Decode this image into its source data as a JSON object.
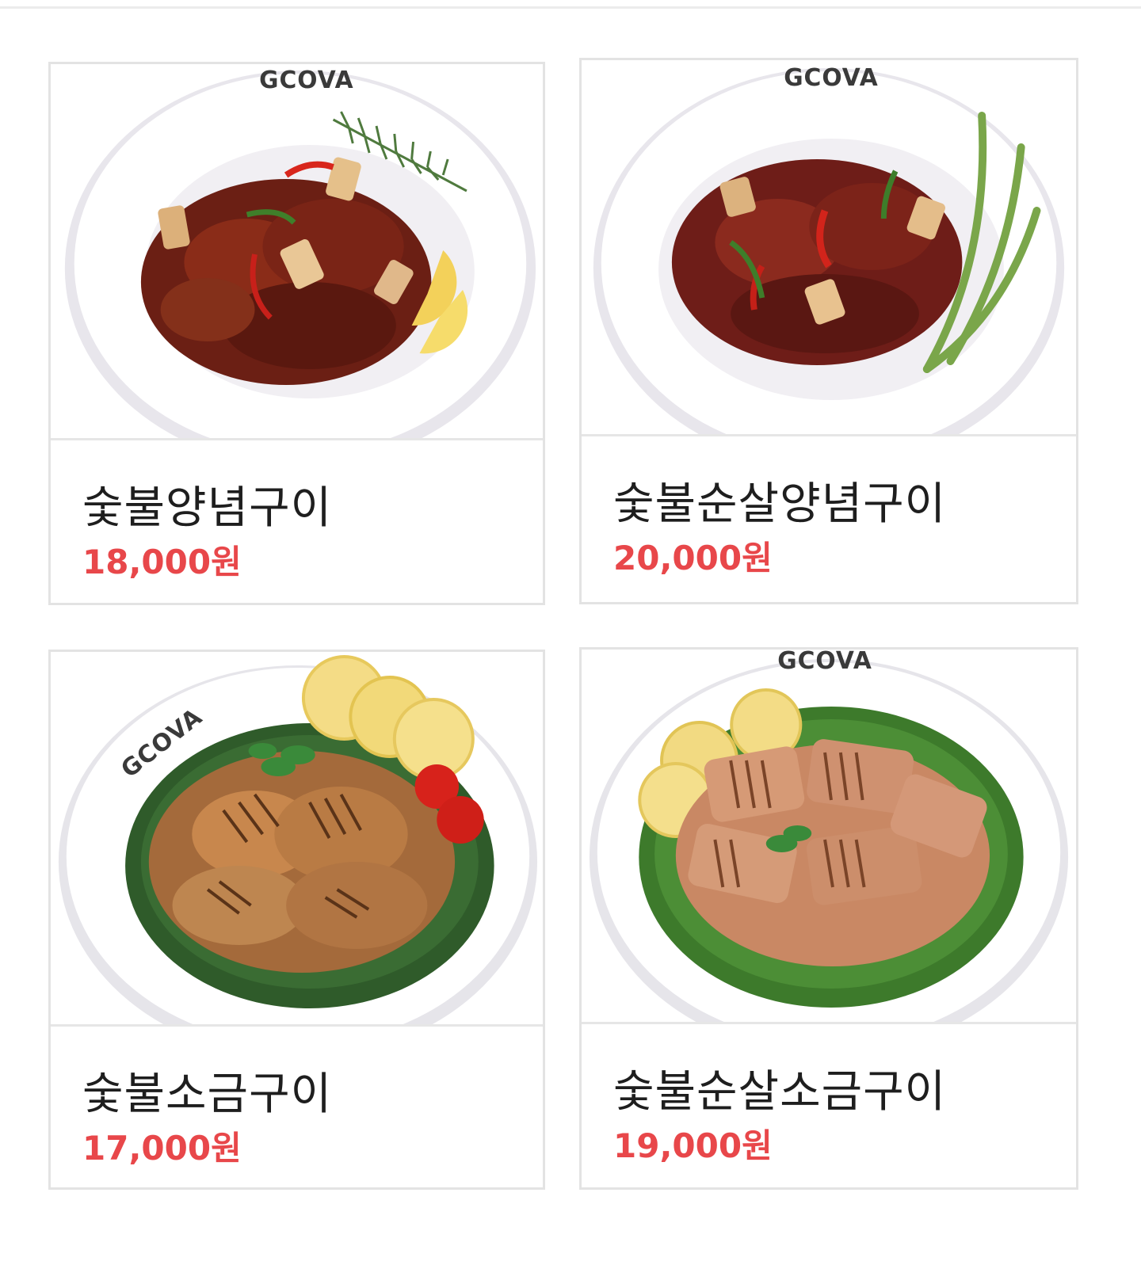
{
  "menu": {
    "items": [
      {
        "name": "숯불양념구이",
        "price": "18,000",
        "currency": "원",
        "plate_brand": "GCOVA",
        "photo_icon": "spicy-chicken-dish"
      },
      {
        "name": "숯불순살양념구이",
        "price": "20,000",
        "currency": "원",
        "plate_brand": "GCOVA",
        "photo_icon": "boneless-spicy-chicken-dish"
      },
      {
        "name": "숯불소금구이",
        "price": "17,000",
        "currency": "원",
        "plate_brand": "GCOVA",
        "photo_icon": "salt-grilled-chicken-dish"
      },
      {
        "name": "숯불순살소금구이",
        "price": "19,000",
        "currency": "원",
        "plate_brand": "GCOVA",
        "photo_icon": "boneless-salt-grilled-chicken-dish"
      }
    ]
  },
  "colors": {
    "price": "#e8474a",
    "name": "#1e1e1e",
    "card_border": "#e3e3e3"
  }
}
